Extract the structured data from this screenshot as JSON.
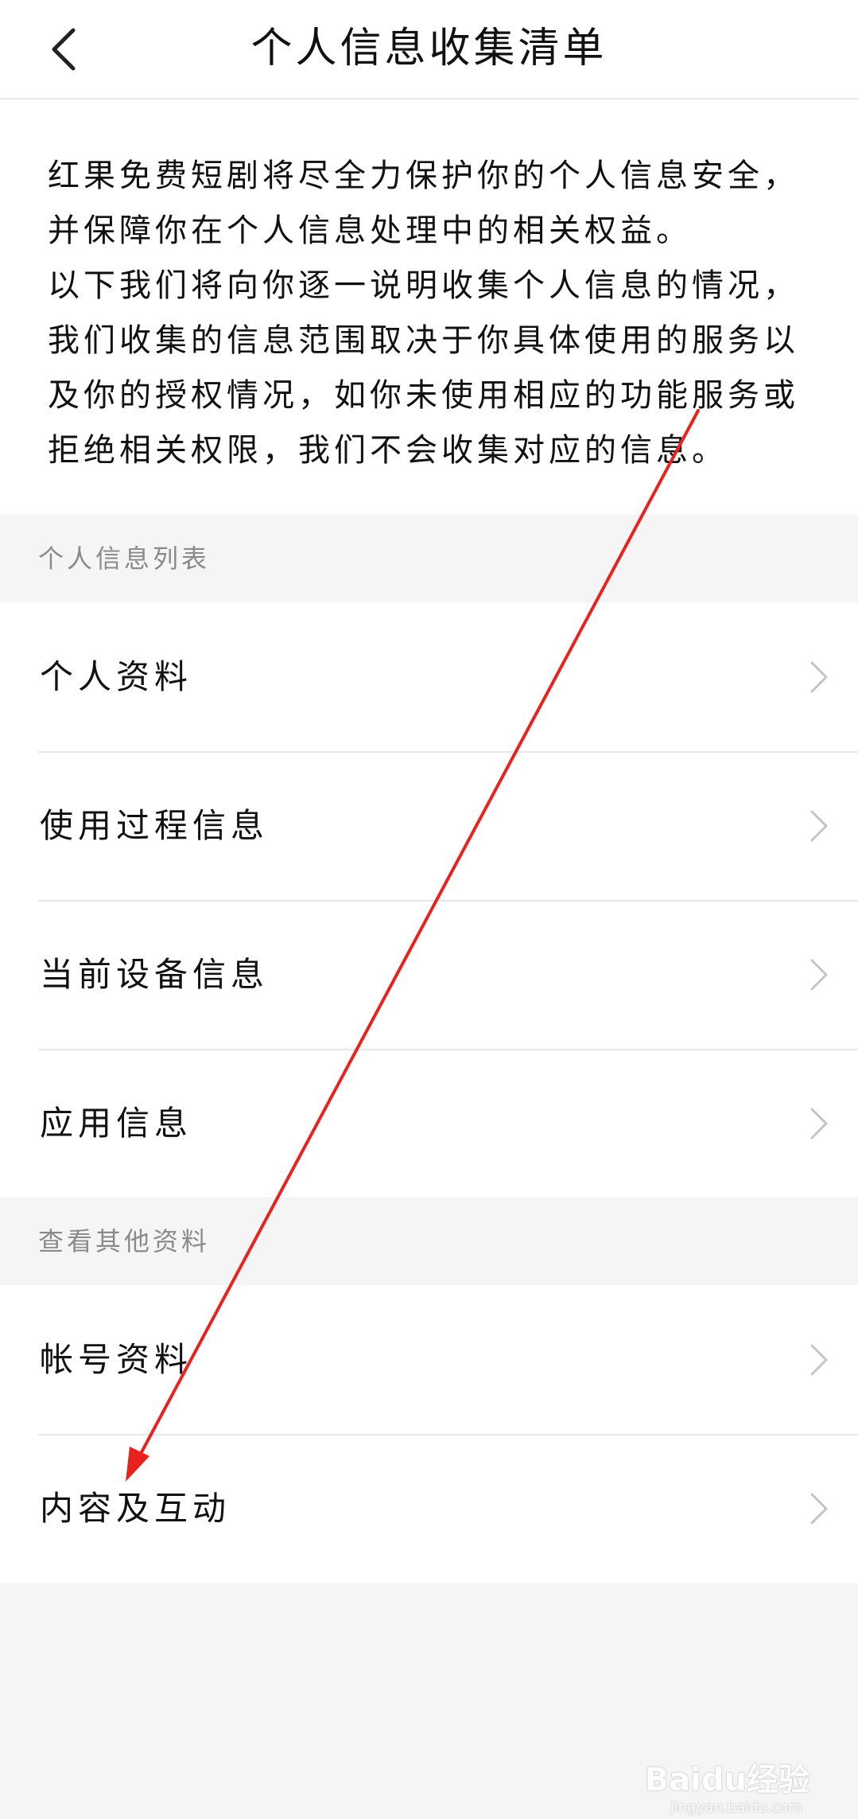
{
  "header": {
    "title": "个人信息收集清单"
  },
  "intro": {
    "paragraph1": "红果免费短剧将尽全力保护你的个人信息安全，并保障你在个人信息处理中的相关权益。",
    "paragraph2": "以下我们将向你逐一说明收集个人信息的情况，我们收集的信息范围取决于你具体使用的服务以及你的授权情况，如你未使用相应的功能服务或拒绝相关权限，我们不会收集对应的信息。"
  },
  "section1": {
    "title": "个人信息列表",
    "items": [
      "个人资料",
      "使用过程信息",
      "当前设备信息",
      "应用信息"
    ]
  },
  "section2": {
    "title": "查看其他资料",
    "items": [
      "帐号资料",
      "内容及互动"
    ]
  },
  "watermark": {
    "brand": "Baidu经验",
    "url": "jingyan.baidu.com"
  },
  "colors": {
    "annotation_arrow": "#e8231e",
    "separator": "#e8e8e8",
    "section_text": "#8a8a8a",
    "chevron": "#c4c4c4"
  }
}
